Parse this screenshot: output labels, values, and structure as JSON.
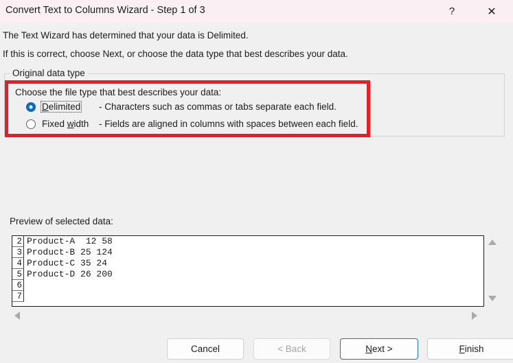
{
  "window": {
    "title": "Convert Text to Columns Wizard - Step 1 of 3",
    "help_label": "?",
    "close_label": "✕",
    "titlebar_color": "#faf0f3",
    "body_color": "#f0f0f0"
  },
  "instructions": {
    "line1": "The Text Wizard has determined that your data is Delimited.",
    "line2": "If this is correct, choose Next, or choose the data type that best describes your data."
  },
  "group": {
    "title": "Original data type",
    "prompt": "Choose the file type that best describes your data:",
    "highlight_color": "#ed1c24",
    "options": [
      {
        "label_pre": "D",
        "label_post": "elimited",
        "accelerator": "D",
        "description": "- Characters such as commas or tabs separate each field.",
        "selected": true,
        "focused": true
      },
      {
        "label_pre": "Fixed ",
        "label_post": "idth",
        "accelerator": "w",
        "description": "- Fields are aligned in columns with spaces between each field.",
        "selected": false,
        "focused": false
      }
    ]
  },
  "preview": {
    "label": "Preview of selected data:",
    "rows": [
      {
        "num": "2",
        "text": "Product-A  12 58"
      },
      {
        "num": "3",
        "text": "Product-B 25 124"
      },
      {
        "num": "4",
        "text": "Product-C 35 24"
      },
      {
        "num": "5",
        "text": "Product-D 26 200"
      },
      {
        "num": "6",
        "text": ""
      },
      {
        "num": "7",
        "text": ""
      }
    ],
    "scroll_up_icon": "triangle-up-icon",
    "scroll_down_icon": "triangle-down-icon",
    "scroll_left_icon": "triangle-left-icon",
    "scroll_right_icon": "triangle-right-icon"
  },
  "footer": {
    "cancel": "Cancel",
    "back": "< Back",
    "next_pre": "N",
    "next_post": "ext >",
    "finish_pre": "F",
    "finish_post": "inish",
    "back_disabled": true,
    "next_is_default": true,
    "default_border_color": "#1477c8"
  }
}
